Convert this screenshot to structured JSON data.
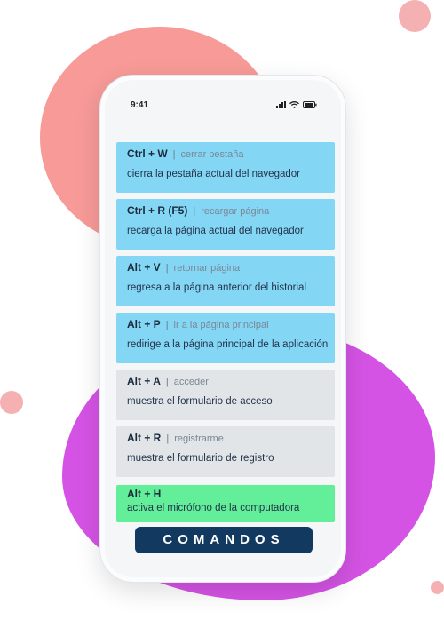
{
  "status_bar": {
    "time": "9:41"
  },
  "commands": [
    {
      "shortcut": "Ctrl + W",
      "action": "cerrar pestaña",
      "description": "cierra la pestaña actual del navegador",
      "style": "blue"
    },
    {
      "shortcut": "Ctrl + R (F5)",
      "action": "recargar página",
      "description": "recarga la página actual del navegador",
      "style": "blue"
    },
    {
      "shortcut": "Alt + V",
      "action": "retornar página",
      "description": "regresa a la página anterior del historial",
      "style": "blue"
    },
    {
      "shortcut": "Alt + P",
      "action": "ir a la página principal",
      "description": "redirige a la página principal de la aplicación",
      "style": "blue"
    },
    {
      "shortcut": "Alt + A",
      "action": "acceder",
      "description": "muestra el formulario de acceso",
      "style": "gray"
    },
    {
      "shortcut": "Alt + R",
      "action": "registrarme",
      "description": "muestra el formulario de registro",
      "style": "gray"
    },
    {
      "shortcut": "Alt + H",
      "action": "",
      "description": "activa el micrófono de la computadora",
      "style": "green"
    }
  ],
  "footer_label": "COMANDOS",
  "colors": {
    "coral_blob": "#f79a98",
    "purple_blob": "#d453e4",
    "card_blue": "#84d6f5",
    "card_gray": "#e2e5e8",
    "card_green": "#63ee99",
    "footer_bg": "#12395f"
  }
}
